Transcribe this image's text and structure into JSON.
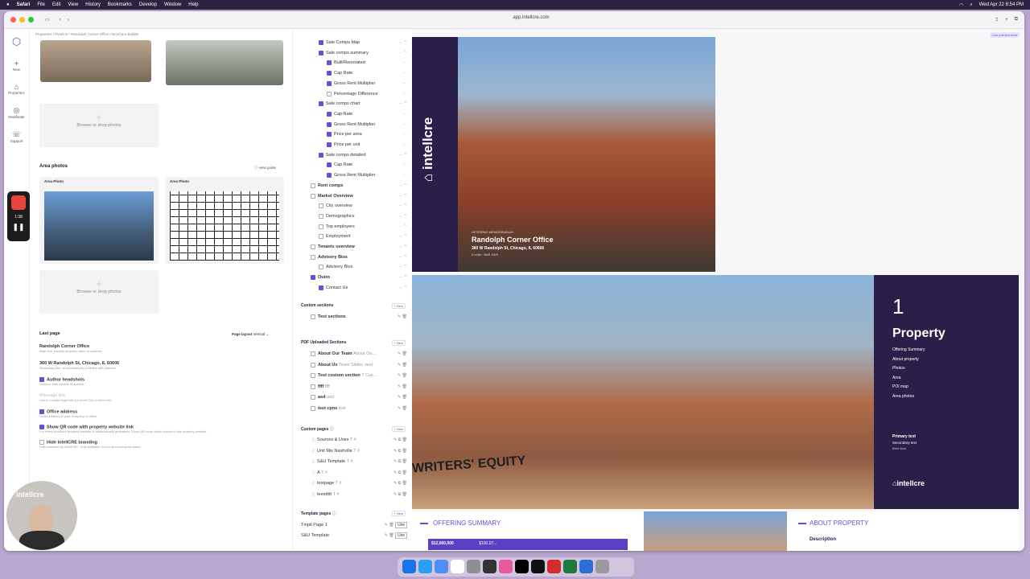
{
  "menubar": {
    "apple": "",
    "app": "Safari",
    "items": [
      "File",
      "Edit",
      "View",
      "History",
      "Bookmarks",
      "Develop",
      "Window",
      "Help"
    ],
    "clock": "Wed Apr 22 8:54 PM"
  },
  "browser": {
    "url": "app.intellcre.com"
  },
  "rail": {
    "new": "New",
    "properties": "Properties",
    "dealfinder": "Dealfinder",
    "support": "Support"
  },
  "recorder": {
    "time": "1:38"
  },
  "left": {
    "breadcrumb": [
      "Properties",
      "Pipeline",
      "Randolph Corner Office",
      "Brochure Builder"
    ],
    "browse": "Browse or drop photos",
    "area_title": "Area photos",
    "view_guide": "view guide",
    "photo_label": "Area Photo",
    "last_page": "Last page",
    "page_layout": "Page layout",
    "layout_value": "Vertical",
    "property_name": "Randolph Corner Office",
    "property_name_hint": "Main line, usually property name or address",
    "address": "360 W Randolph St, Chicago, IL 60606",
    "address_hint": "Secondary line, is automatically prefilled with address",
    "author_headshots": "Author headshots",
    "author_hint": "Show or hide photos of authors",
    "message_line": "Message line",
    "message_hint": "Use to include legal info (i.e short CA) or other info",
    "office_address": "Office address",
    "office_hint": "Show address of your company or office",
    "qr": "Show QR code with property website link",
    "qr_hint": "For every brochure property website is automatically generated. Show QR code which directs to this property website",
    "hide_branding": "Hide IntellCRE branding",
    "branding_hint": "Hide powered by IntellCRE. Only available for pro and enterprise plans."
  },
  "mid": {
    "items": [
      {
        "label": "Sale Comps Map",
        "checked": true,
        "indent": 1
      },
      {
        "label": "Sale comps summary",
        "checked": true,
        "indent": 1
      },
      {
        "label": "Built/Renovated",
        "checked": true,
        "indent": 2
      },
      {
        "label": "Cap Rate",
        "checked": true,
        "indent": 2
      },
      {
        "label": "Gross Rent Multiplier",
        "checked": true,
        "indent": 2
      },
      {
        "label": "Percentage Difference",
        "checked": false,
        "indent": 2
      },
      {
        "label": "Sale comps chart",
        "checked": true,
        "indent": 1
      },
      {
        "label": "Cap Rate",
        "checked": true,
        "indent": 2
      },
      {
        "label": "Gross Rent Multiplier",
        "checked": true,
        "indent": 2
      },
      {
        "label": "Price per area",
        "checked": true,
        "indent": 2
      },
      {
        "label": "Price per unit",
        "checked": true,
        "indent": 2
      },
      {
        "label": "Sale comps detailed",
        "checked": true,
        "indent": 1
      },
      {
        "label": "Cap Rate",
        "checked": true,
        "indent": 2
      },
      {
        "label": "Gross Rent Multiplier",
        "checked": true,
        "indent": 2
      },
      {
        "label": "Rent comps",
        "checked": false,
        "indent": 0
      },
      {
        "label": "Market Overview",
        "checked": false,
        "indent": 0
      },
      {
        "label": "City overview",
        "checked": false,
        "indent": 1
      },
      {
        "label": "Demographics",
        "checked": false,
        "indent": 1
      },
      {
        "label": "Top employers",
        "checked": false,
        "indent": 1
      },
      {
        "label": "Employment",
        "checked": false,
        "indent": 1
      },
      {
        "label": "Tenants overview",
        "checked": false,
        "indent": 0
      },
      {
        "label": "Advisory Bios",
        "checked": false,
        "indent": 0
      },
      {
        "label": "Advisory Bios",
        "checked": false,
        "indent": 1
      },
      {
        "label": "Outro",
        "checked": true,
        "indent": 0
      },
      {
        "label": "Contact Us",
        "checked": true,
        "indent": 1
      }
    ],
    "custom_sections": "Custom sections",
    "new": "+ New",
    "test_sections": "Test sections",
    "pdf_sections": "PDF Uploaded Sections",
    "pdf_items": [
      {
        "label": "About Our Team",
        "sub": "About Ou..."
      },
      {
        "label": "About Us",
        "sub": "Team Slides -test"
      },
      {
        "label": "Test custom section",
        "sub": "7 Cus..."
      },
      {
        "label": "ffff",
        "sub": "ffff"
      },
      {
        "label": "asd",
        "sub": "asd"
      },
      {
        "label": "test cpns",
        "sub": "test"
      }
    ],
    "custom_pages": "Custom pages",
    "page_items": [
      "Sources & Uses",
      "Unit Mix Nashville",
      "S&U Template",
      "A",
      "testpage",
      "teesttttt"
    ],
    "page_suffix": "T #",
    "template_pages": "Template pages",
    "template_items": [
      "Tmplt Page 1",
      "S&U Template"
    ],
    "use": "Use"
  },
  "preview": {
    "badge": "Live preview beta",
    "brand": "intellcre",
    "om": "OFFERING MEMORANDUM",
    "title": "Randolph Corner Office",
    "address": "360 W Randolph St, Chicago, IL 60606",
    "meta": "0 units · Built 1920",
    "page_num": "1",
    "page_title": "Property",
    "toc": [
      "Offering Summary",
      "About property",
      "Photos",
      "Area",
      "POI map",
      "Area photos"
    ],
    "primary": "Primary text",
    "secondary": "Secondary text",
    "tertiary": "Best deal",
    "offering_summary": "OFFERING SUMMARY",
    "about_property": "ABOUT PROPERTY",
    "description": "Description",
    "price": "$12,000,000",
    "price2": "$100.07..."
  },
  "camera": {
    "text": "intellcre"
  },
  "colors": {
    "accent": "#6a4fd6",
    "dark_purple": "#2a1f48",
    "menubar": "#2a2440"
  }
}
